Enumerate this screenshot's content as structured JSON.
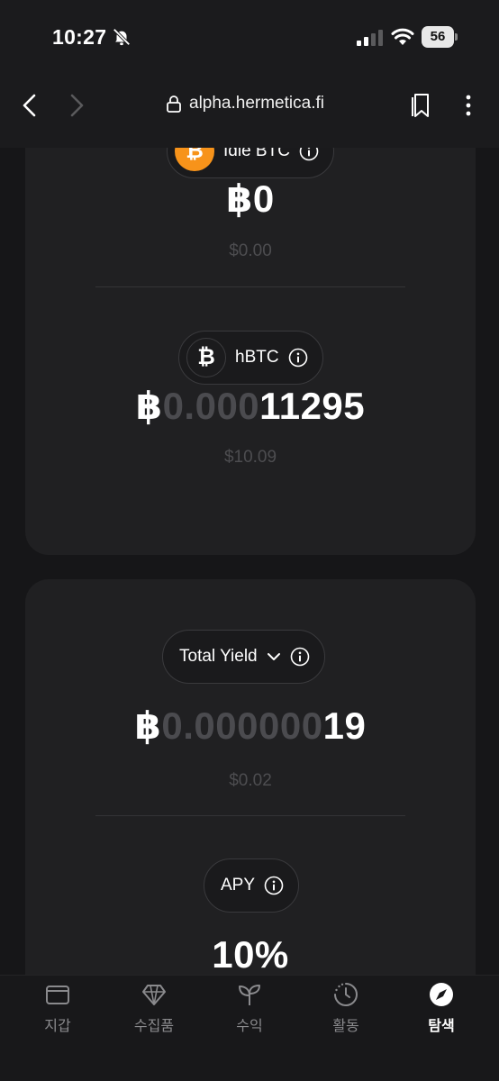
{
  "status_bar": {
    "time": "10:27",
    "battery": "56"
  },
  "browser": {
    "url": "alpha.hermetica.fi"
  },
  "idle_btc": {
    "label": "Idle BTC",
    "amount": "฿0",
    "usd": "$0.00"
  },
  "hbtc": {
    "label": "hBTC",
    "amount_symbol": "฿",
    "amount_dim": "0.000",
    "amount_value": "11295",
    "usd": "$10.09"
  },
  "total_yield": {
    "label": "Total Yield",
    "amount_symbol": "฿",
    "amount_dim": "0.000000",
    "amount_value": "19",
    "usd": "$0.02"
  },
  "apy": {
    "label": "APY",
    "value": "10%"
  },
  "tabs": [
    {
      "label": "지갑",
      "icon": "wallet-icon",
      "active": false
    },
    {
      "label": "수집품",
      "icon": "diamond-icon",
      "active": false
    },
    {
      "label": "수익",
      "icon": "sprout-icon",
      "active": false
    },
    {
      "label": "활동",
      "icon": "clock-icon",
      "active": false
    },
    {
      "label": "탐색",
      "icon": "compass-icon",
      "active": true
    }
  ],
  "colors": {
    "background": "#161618",
    "card": "#202022",
    "btc_orange": "#f7931a",
    "dim_text": "#4b4b4f"
  }
}
